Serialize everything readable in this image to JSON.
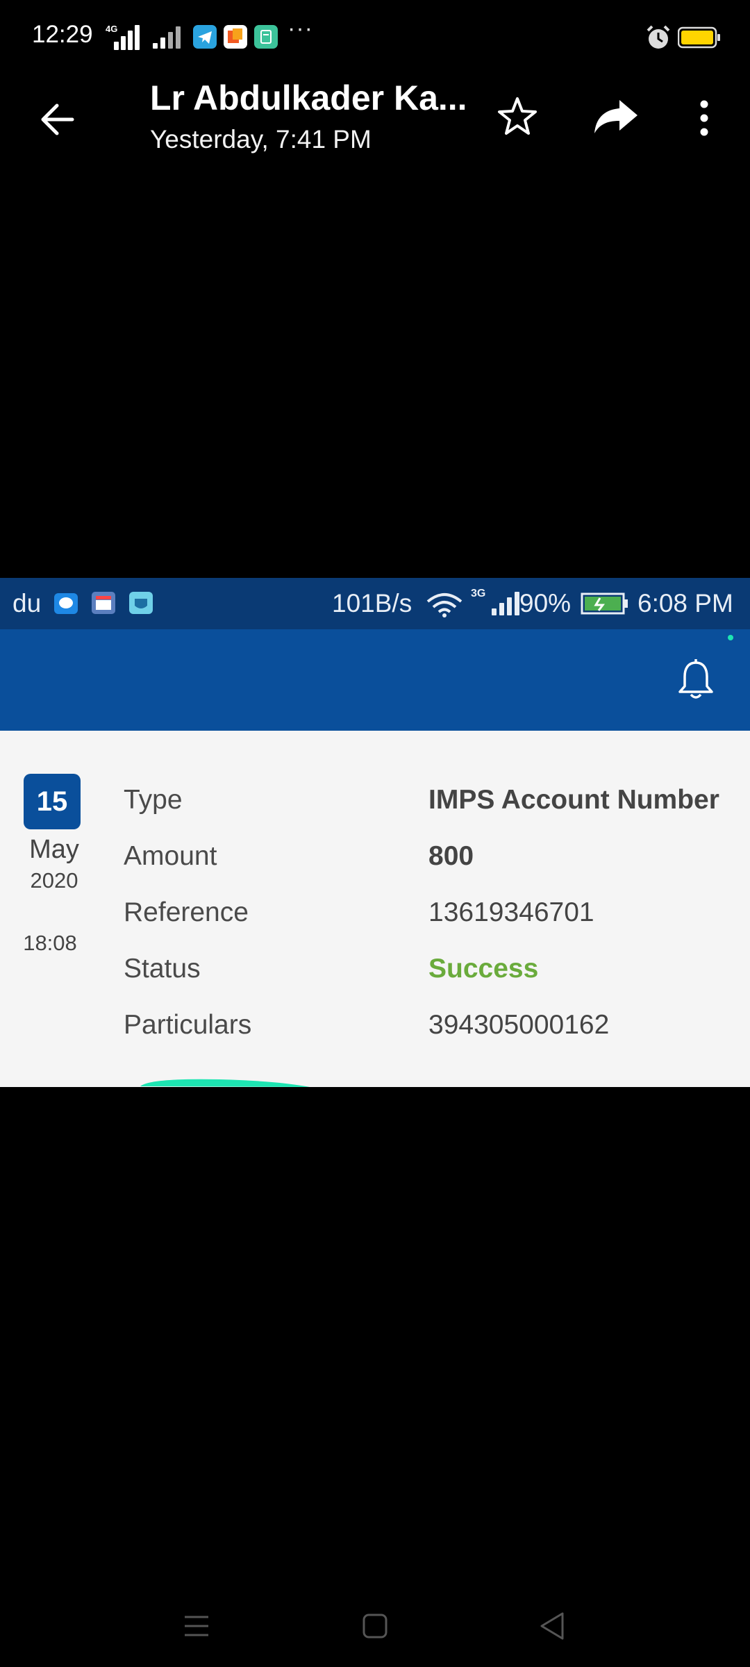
{
  "status_bar": {
    "time": "12:29",
    "network": "4G",
    "icons": [
      "signal-icon",
      "telegram-icon",
      "app-icon",
      "app-icon",
      "more-icon",
      "alarm-icon",
      "battery-icon"
    ],
    "more": "···"
  },
  "header": {
    "title": "Lr Abdulkader Ka...",
    "subtitle": "Yesterday, 7:41 PM"
  },
  "image": {
    "status_bar": {
      "carrier": "du",
      "speed": "101B/s",
      "network": "3G",
      "battery": "90%",
      "time": "6:08 PM"
    },
    "transaction": {
      "day": "15",
      "month": "May",
      "year": "2020",
      "time": "18:08",
      "rows": [
        {
          "label": "Type",
          "value": "IMPS Account Number"
        },
        {
          "label": "Amount",
          "value": "800"
        },
        {
          "label": "Reference",
          "value": "13619346701"
        },
        {
          "label": "Status",
          "value": "Success"
        },
        {
          "label": "Particulars",
          "value": "394305000162"
        }
      ]
    }
  },
  "colors": {
    "inner_status_bar": "#0a3a74",
    "inner_header": "#0a4f9b",
    "status_success": "#6aab3c",
    "highlight_stroke": "#1de5b2"
  }
}
